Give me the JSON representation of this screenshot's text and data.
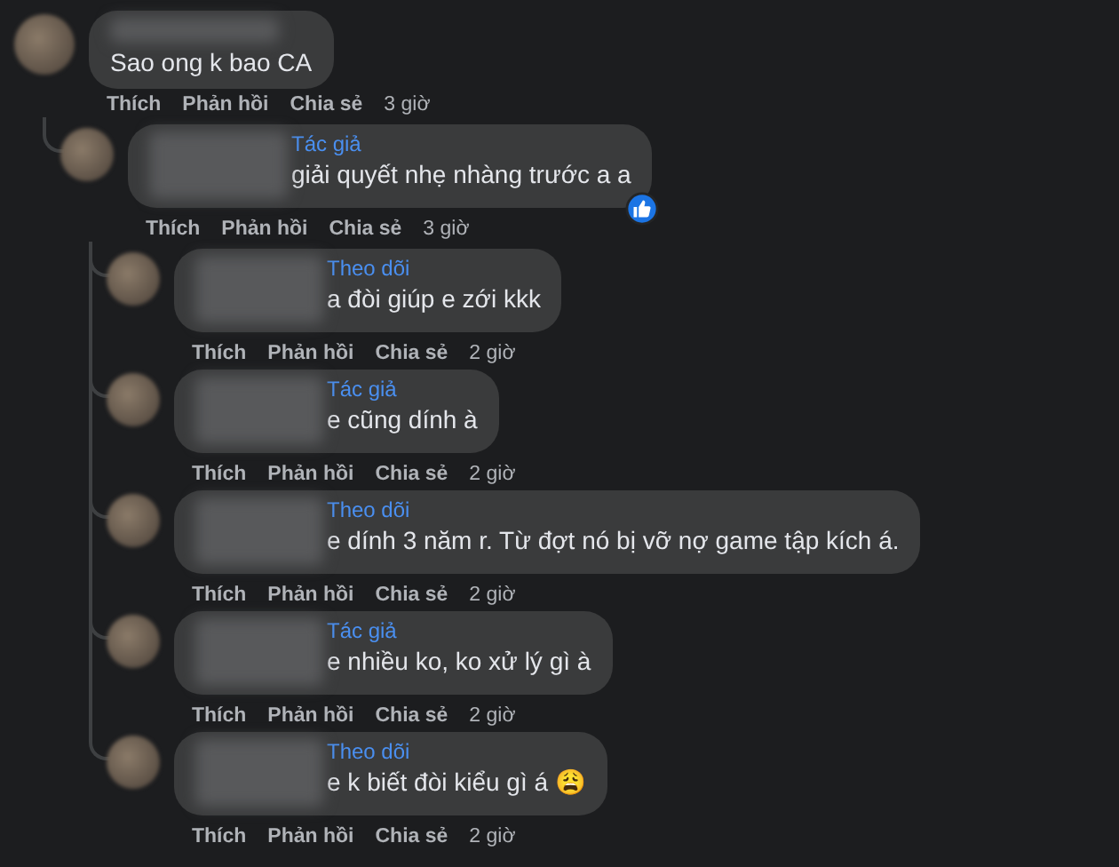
{
  "comments": [
    {
      "text": "Sao ong k bao CA",
      "actions": [
        "Thích",
        "Phản hồi",
        "Chia sẻ"
      ],
      "time": "3 giờ",
      "children": [
        {
          "badge": "Tác giả",
          "text": "giải quyết nhẹ nhàng trước a a",
          "reacted": true,
          "actions": [
            "Thích",
            "Phản hồi",
            "Chia sẻ"
          ],
          "time": "3 giờ",
          "children": [
            {
              "badge": "Theo dõi",
              "text": "a đòi giúp e zới kkk",
              "actions": [
                "Thích",
                "Phản hồi",
                "Chia sẻ"
              ],
              "time": "2 giờ"
            },
            {
              "badge": "Tác giả",
              "text": "e cũng dính à",
              "actions": [
                "Thích",
                "Phản hồi",
                "Chia sẻ"
              ],
              "time": "2 giờ"
            },
            {
              "badge": "Theo dõi",
              "text": "e dính 3 năm r. Từ đợt nó bị vỡ nợ game tập kích á.",
              "actions": [
                "Thích",
                "Phản hồi",
                "Chia sẻ"
              ],
              "time": "2 giờ"
            },
            {
              "badge": "Tác giả",
              "text": "e nhiều ko, ko xử lý gì à",
              "actions": [
                "Thích",
                "Phản hồi",
                "Chia sẻ"
              ],
              "time": "2 giờ"
            },
            {
              "badge": "Theo dõi",
              "text": "e k biết đòi kiểu gì á",
              "emoji": "😩",
              "actions": [
                "Thích",
                "Phản hồi",
                "Chia sẻ"
              ],
              "time": "2 giờ"
            }
          ]
        }
      ]
    }
  ]
}
